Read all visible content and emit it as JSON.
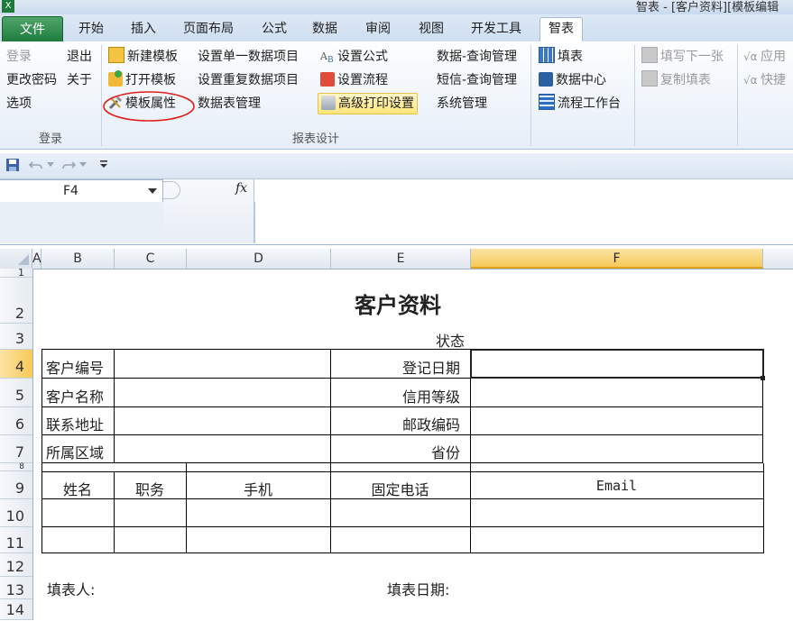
{
  "window": {
    "title": "智表 - [客户资料][模板编辑"
  },
  "tabs": [
    "文件",
    "开始",
    "插入",
    "页面布局",
    "公式",
    "数据",
    "审阅",
    "视图",
    "开发工具",
    "智表"
  ],
  "ribbon": {
    "login_group": {
      "label": "登录",
      "items": [
        "登录",
        "退出",
        "更改密码",
        "关于",
        "选项"
      ]
    },
    "report_group": {
      "label": "报表设计",
      "col1": [
        "新建模板",
        "打开模板",
        "模板属性"
      ],
      "col2": [
        "设置单一数据项目",
        "设置重复数据项目",
        "数据表管理"
      ],
      "col3": [
        "设置公式",
        "设置流程",
        "高级打印设置"
      ],
      "col4": [
        "数据-查询管理",
        "短信-查询管理",
        "系统管理"
      ]
    },
    "fill_group": {
      "items": [
        "填表",
        "数据中心",
        "流程工作台"
      ]
    },
    "next_group": {
      "items": [
        "填写下一张",
        "复制填表"
      ]
    },
    "apply_group": {
      "items": [
        "应用",
        "快捷"
      ]
    }
  },
  "formula_bar": {
    "name_box": "F4",
    "fx": "fx",
    "value": ""
  },
  "columns": [
    "A",
    "B",
    "C",
    "D",
    "E",
    "F"
  ],
  "rows": [
    "1",
    "2",
    "3",
    "4",
    "5",
    "6",
    "7",
    "8",
    "9",
    "10",
    "11",
    "12",
    "13",
    "14"
  ],
  "sheet": {
    "title": "客户资料",
    "status_label": "状态",
    "fields": {
      "customer_no": "客户编号",
      "register_date": "登记日期",
      "customer_name": "客户名称",
      "credit_level": "信用等级",
      "address": "联系地址",
      "postcode": "邮政编码",
      "region": "所属区域",
      "province": "省份"
    },
    "contact_headers": [
      "姓名",
      "职务",
      "手机",
      "固定电话",
      "Email"
    ],
    "filler_label": "填表人:",
    "fill_date_label": "填表日期:"
  },
  "colors": {
    "file_tab": "#1e7b3d",
    "selection": "#f7c957",
    "annotation_circle": "#e0201c"
  }
}
